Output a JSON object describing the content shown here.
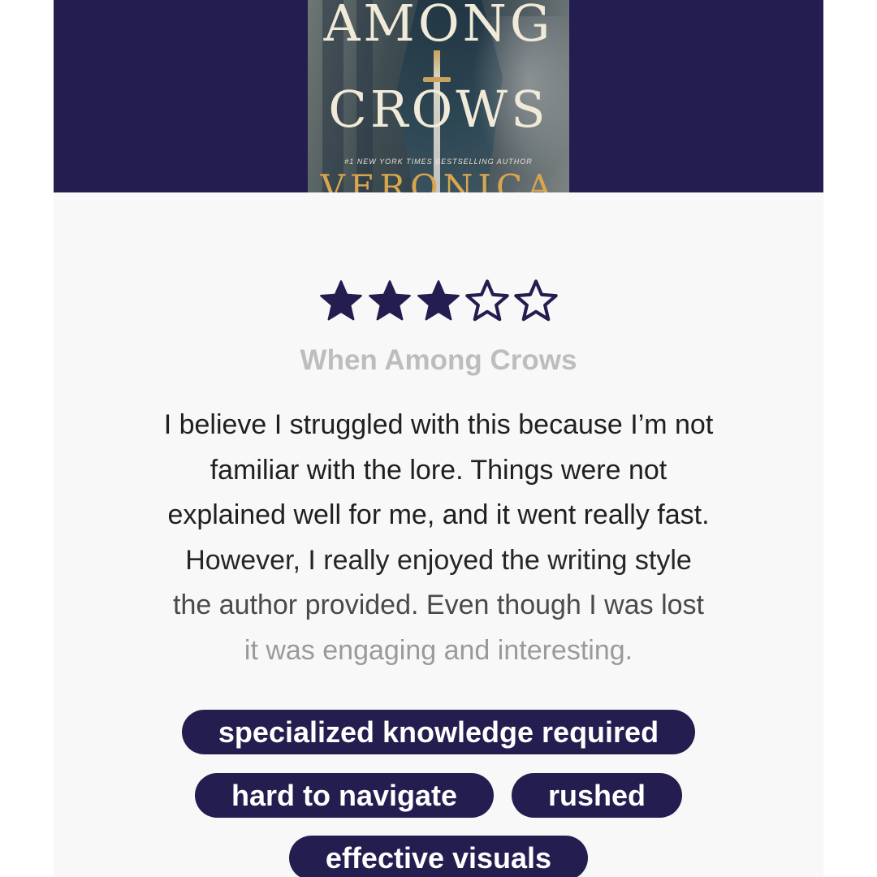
{
  "colors": {
    "accent": "#241d4f",
    "background": "#f8f8f8",
    "title_gray": "#bdbdbd",
    "text_dark": "#1f1f1f"
  },
  "cover": {
    "title_lines": [
      "AMONG",
      "CROWS"
    ],
    "tagline": "#1 NEW YORK TIMES BESTSELLING AUTHOR",
    "author_partial": "VERONICA"
  },
  "rating": {
    "value": 3,
    "max": 5,
    "filled_icon": "star-filled-icon",
    "empty_icon": "star-outline-icon"
  },
  "review": {
    "book_title": "When Among Crows",
    "lines": [
      "I believe I struggled with this because I’m not",
      "familiar with the lore. Things were not",
      "explained well for me, and it went really fast.",
      "However, I really enjoyed the writing style",
      "the author provided. Even though I was lost",
      "it was engaging and interesting."
    ],
    "line_colors": [
      "#1f1f1f",
      "#1f1f1f",
      "#1f1f1f",
      "#262626",
      "#4a4a4a",
      "#9a9a9a"
    ]
  },
  "tags": {
    "rows": [
      [
        "specialized knowledge required"
      ],
      [
        "hard to navigate",
        "rushed"
      ],
      [
        "effective visuals"
      ]
    ]
  }
}
